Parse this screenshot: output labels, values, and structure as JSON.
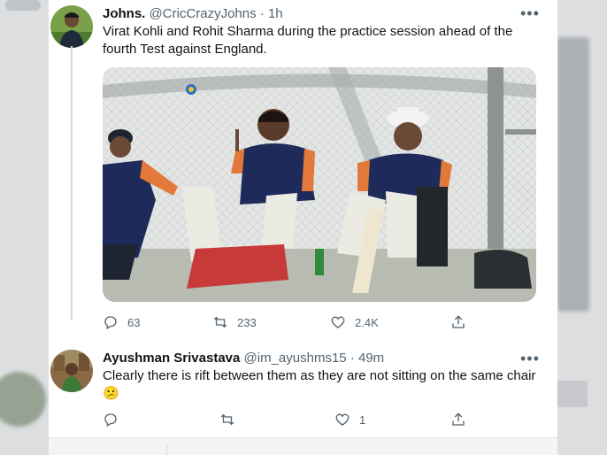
{
  "tweet": {
    "author_name": "Johns.",
    "handle": "@CricCrazyJohns",
    "separator": "·",
    "time": "1h",
    "text": "Virat Kohli and Rohit Sharma during the practice session ahead of the fourth Test against England.",
    "media_icon": "cricket-practice-photo",
    "actions": {
      "reply_count": "63",
      "retweet_count": "233",
      "like_count": "2.4K"
    }
  },
  "reply": {
    "author_name": "Ayushman Srivastava",
    "handle": "@im_ayushms15",
    "separator": "·",
    "time": "49m",
    "text": "Clearly there is rift between them as they are not sitting on the same chair",
    "emoji": "😕",
    "actions": {
      "reply_count": "",
      "retweet_count": "",
      "like_count": "1"
    }
  },
  "colors": {
    "text_primary": "#0f1419",
    "text_secondary": "#536471",
    "thread_line": "#cfd9de",
    "card_background": "#ffffff"
  }
}
